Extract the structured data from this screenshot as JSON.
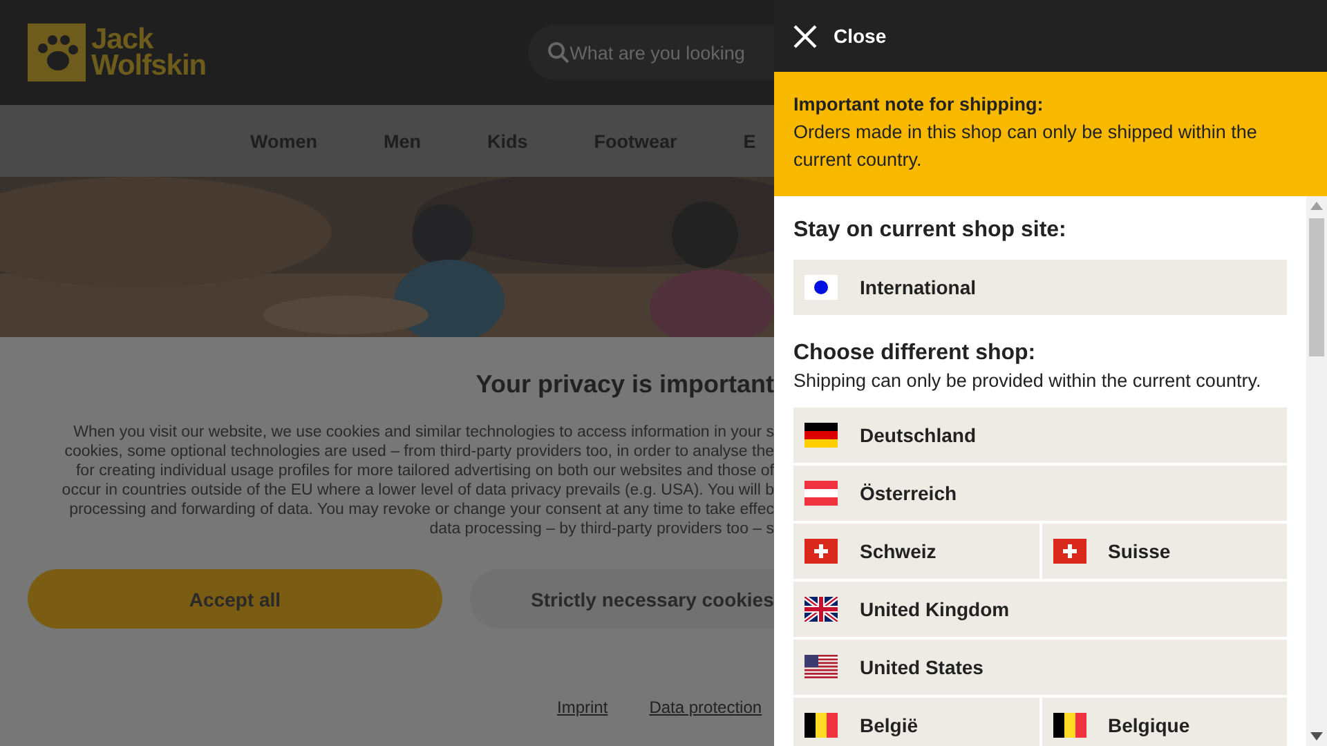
{
  "header": {
    "logo_lines": [
      "Jack",
      "Wolfskin"
    ],
    "search": {
      "placeholder": "What are you looking"
    }
  },
  "nav": [
    "Women",
    "Men",
    "Kids",
    "Footwear",
    "E"
  ],
  "hero": {
    "kind": "picture"
  },
  "privacy": {
    "title": "Your privacy is important",
    "lines": [
      "When you visit our website, we use cookies and similar technologies to access information in your s",
      "cookies, some optional technologies are used – from third-party providers too, in order to analyse the",
      "for creating individual usage profiles for more tailored advertising on both our websites and those of",
      "occur in countries outside of the EU where a lower level of data privacy prevails (e.g. USA). You will b",
      "processing and forwarding of data. You may revoke or change your consent at any time to take effec",
      "data processing – by third-party providers too – s"
    ],
    "buttons": [
      {
        "label": "Accept all",
        "kind": "primary"
      },
      {
        "label": "Strictly necessary cookies",
        "kind": "secondary"
      }
    ],
    "links": [
      "Imprint",
      "Data protection"
    ]
  },
  "panel": {
    "close": "Close",
    "note": {
      "title": "Important note for shipping:",
      "text": "Orders made in this shop can only be shipped within the current country."
    },
    "current": {
      "heading": "Stay on current shop site:",
      "rows": [
        [
          {
            "label": "International",
            "kind": "intl"
          }
        ]
      ]
    },
    "other": {
      "heading": "Choose different shop:",
      "subtitle": "Shipping can only be provided within the current country.",
      "rows": [
        [
          {
            "label": "Deutschland",
            "kind": "de"
          }
        ],
        [
          {
            "label": "Österreich",
            "kind": "at"
          }
        ],
        [
          {
            "label": "Schweiz",
            "kind": "ch"
          },
          {
            "label": "Suisse",
            "kind": "ch"
          }
        ],
        [
          {
            "label": "United Kingdom",
            "kind": "gb"
          }
        ],
        [
          {
            "label": "United States",
            "kind": "us"
          }
        ],
        [
          {
            "label": "België",
            "kind": "be"
          },
          {
            "label": "Belgique",
            "kind": "be"
          }
        ]
      ]
    }
  }
}
